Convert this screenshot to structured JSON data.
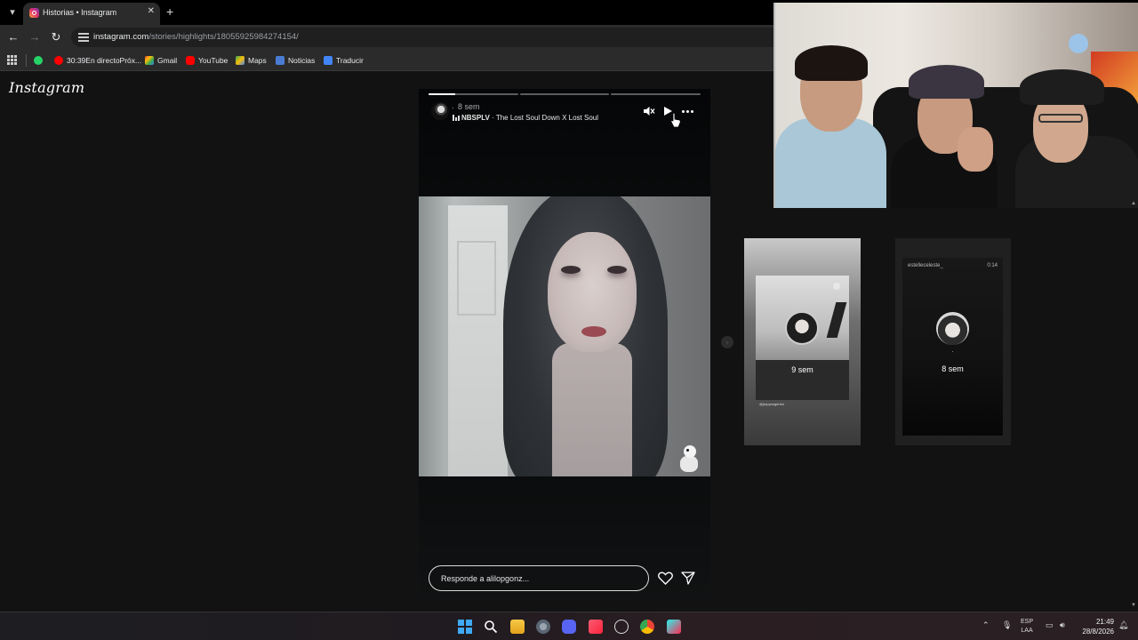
{
  "browser": {
    "tab_title": "Historias • Instagram",
    "url_host": "instagram.com",
    "url_path": "/stories/highlights/18055925984274154/",
    "bookmarks": [
      {
        "label": "30:39En directoPróx...",
        "icon": "youtube-live-icon"
      },
      {
        "label": "Gmail",
        "icon": "gmail-icon"
      },
      {
        "label": "YouTube",
        "icon": "youtube-icon"
      },
      {
        "label": "Maps",
        "icon": "maps-icon"
      },
      {
        "label": "Noticias",
        "icon": "news-icon"
      },
      {
        "label": "Traducir",
        "icon": "translate-icon"
      }
    ]
  },
  "instagram": {
    "logo": "Instagram",
    "story": {
      "dot": ".",
      "time": "8 sem",
      "music_artist": "NBSPLV",
      "music_song": " · The Lost Soul Down X Lost Soul",
      "progress_segments": [
        0.3,
        0,
        0
      ],
      "reply_placeholder": "Responde a alilopgonz..."
    },
    "previews": [
      {
        "time": "9 sem",
        "caption": "@jmpyangerlnn"
      },
      {
        "user": "estelleceleste_",
        "duration": "0:14",
        "dot": ".",
        "time": "8 sem"
      }
    ]
  },
  "taskbar": {
    "lang_line1": "ESP",
    "lang_line2": "LAA",
    "time": "21:49",
    "date": "28/8/2026"
  },
  "colors": {
    "background": "#121212",
    "chrome": "#2b2b2b",
    "accent_blue": "#3fa9f5",
    "instagram_gradient": [
      "#f9a23a",
      "#e1306c",
      "#833ab4"
    ]
  }
}
